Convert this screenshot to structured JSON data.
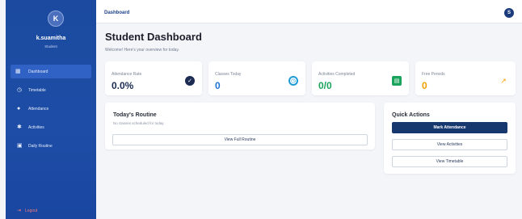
{
  "sidebar": {
    "avatar_letter": "K",
    "user_name": "k.suamitha",
    "user_role": "Student",
    "items": [
      {
        "label": "Dashboard",
        "icon": "grid-icon",
        "active": true
      },
      {
        "label": "Timetable",
        "icon": "clock-icon",
        "active": false
      },
      {
        "label": "Attendance",
        "icon": "check-circle-icon",
        "active": false
      },
      {
        "label": "Activities",
        "icon": "gear-icon",
        "active": false
      },
      {
        "label": "Daily Routine",
        "icon": "calendar-icon",
        "active": false
      }
    ],
    "logout_label": "Logout"
  },
  "topbar": {
    "breadcrumb": "Dashboard",
    "avatar_letter": "S"
  },
  "header": {
    "title": "Student Dashboard",
    "subtitle": "Welcome! Here's your overview for today."
  },
  "stats": [
    {
      "label": "Attendance Rate",
      "value": "0.0%",
      "color": "#1b2b52",
      "icon": "check-badge-icon",
      "icon_bg": "#1b2b52"
    },
    {
      "label": "Classes Today",
      "value": "0",
      "color": "#1e73d6",
      "icon": "clock-icon",
      "icon_bg": "#1e9bd6"
    },
    {
      "label": "Activities Completed",
      "value": "0/0",
      "color": "#1aa35c",
      "icon": "task-icon",
      "icon_bg": "#1aa35c"
    },
    {
      "label": "Free Periods",
      "value": "0",
      "color": "#f0a000",
      "icon": "trending-up-icon",
      "icon_bg": "transparent"
    }
  ],
  "routine": {
    "title": "Today's Routine",
    "empty_text": "No classes scheduled for today.",
    "button": "View Full Routine"
  },
  "quick_actions": {
    "title": "Quick Actions",
    "buttons": [
      "Mark Attendance",
      "View Activities",
      "View Timetable"
    ]
  }
}
